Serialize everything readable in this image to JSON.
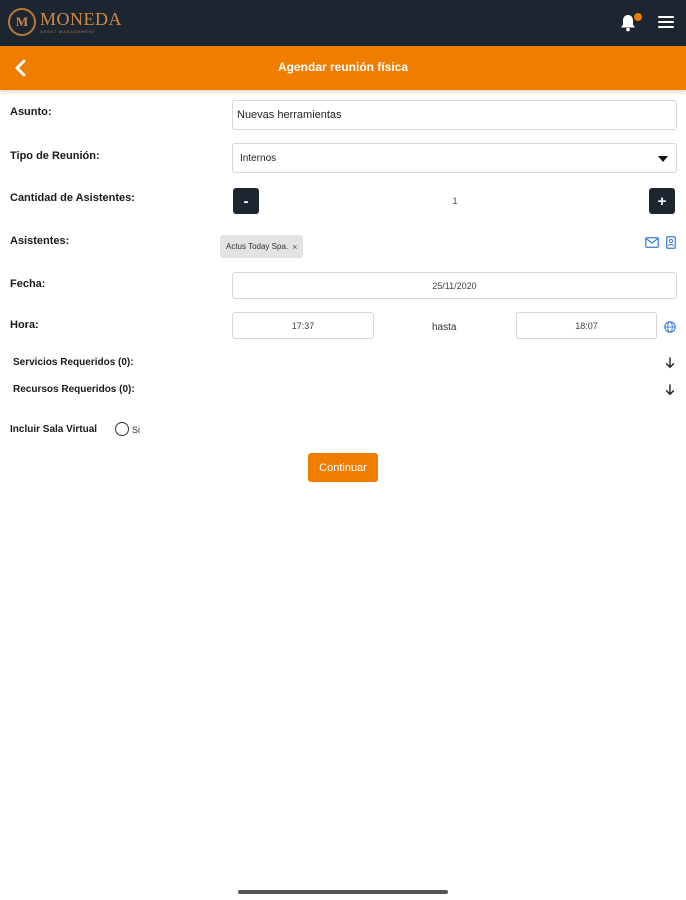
{
  "app": {
    "brand": "MONEDA",
    "brand_tagline": "ASSET MANAGEMENT",
    "notification_badge_color": "#ef7d00"
  },
  "colors": {
    "topbar": "#1c2530",
    "accent": "#ef7d00"
  },
  "header": {
    "title": "Agendar reunión física",
    "back_icon": "chevron-left-icon"
  },
  "form": {
    "subject": {
      "label": "Asunto:",
      "value": "Nuevas herramientas"
    },
    "meeting_type": {
      "label": "Tipo de Reunión:",
      "value": "Internos"
    },
    "attendee_count": {
      "label": "Cantidad de Asistentes:",
      "minus": "-",
      "plus": "+",
      "value": "1"
    },
    "attendees": {
      "label": "Asistentes:",
      "chips": [
        {
          "label": "Actus Today Spa.",
          "remove": "×"
        }
      ]
    },
    "date": {
      "label": "Fecha:",
      "value": "25/11/2020"
    },
    "time": {
      "label": "Hora:",
      "from": "17:37",
      "separator": "hasta",
      "to": "18:07"
    },
    "services": {
      "label": "Servicios Requeridos (0):"
    },
    "resources": {
      "label": "Recursos Requeridos (0):"
    },
    "virtual_room": {
      "label": "Incluir Sala Virtual",
      "option": "Si"
    },
    "submit": "Continuar"
  }
}
